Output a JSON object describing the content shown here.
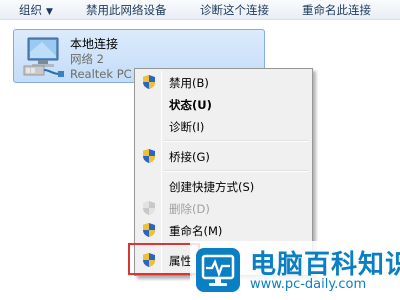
{
  "toolbar": {
    "organize": "组织",
    "disable_device": "禁用此网络设备",
    "diagnose": "诊断这个连接",
    "rename": "重命名此连接"
  },
  "connection": {
    "name": "本地连接",
    "network": "网络  2",
    "adapter": "Realtek PC",
    "icon": "network-adapter-icon"
  },
  "context_menu": {
    "items": [
      {
        "label": "禁用(B)",
        "icon": "shield-icon",
        "bold": false,
        "disabled": false
      },
      {
        "label": "状态(U)",
        "icon": "",
        "bold": true,
        "disabled": false
      },
      {
        "label": "诊断(I)",
        "icon": "",
        "bold": false,
        "disabled": false
      },
      {
        "label": "桥接(G)",
        "icon": "shield-icon",
        "bold": false,
        "disabled": false
      },
      {
        "label": "创建快捷方式(S)",
        "icon": "",
        "bold": false,
        "disabled": false
      },
      {
        "label": "删除(D)",
        "icon": "shield-icon",
        "bold": false,
        "disabled": true
      },
      {
        "label": "重命名(M)",
        "icon": "shield-icon",
        "bold": false,
        "disabled": false
      },
      {
        "label": "属性",
        "icon": "shield-icon",
        "bold": false,
        "disabled": false
      }
    ]
  },
  "watermark": {
    "title": "电脑百科知识",
    "url": "www.pc-daily.com"
  },
  "colors": {
    "toolbar_text": "#1e395b",
    "selection": "#c4dcf8",
    "highlight": "#e0322f",
    "watermark": "#0b7fc4"
  }
}
